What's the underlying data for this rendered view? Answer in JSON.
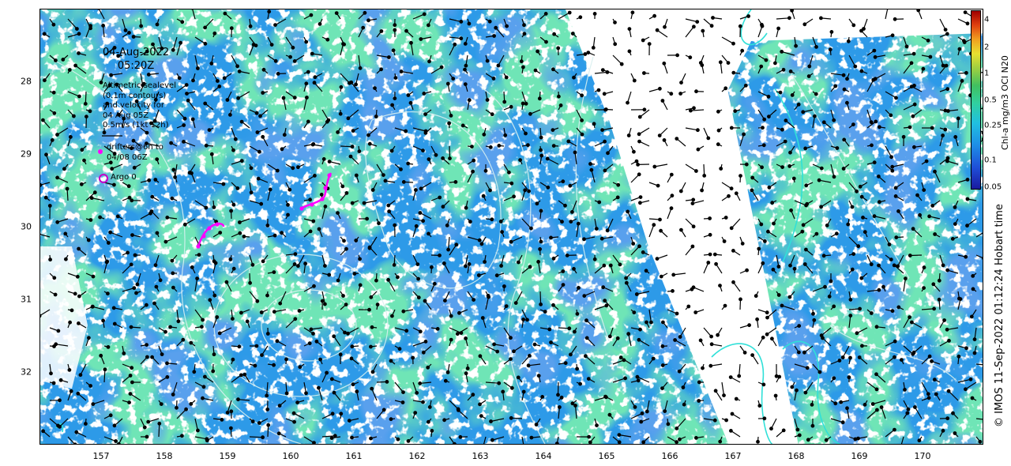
{
  "map": {
    "date_line1": "04-Aug-2022",
    "date_line2": "05:20Z",
    "x_ticks": [
      "157",
      "158",
      "159",
      "160",
      "161",
      "162",
      "163",
      "164",
      "165",
      "166",
      "167",
      "168",
      "169",
      "170"
    ],
    "y_ticks": [
      "28",
      "29",
      "30",
      "31",
      "32"
    ],
    "legend": {
      "altimetry": "Altimetric sealevel\n(0.1m contours)\nand velocity for\n04 Aug 05Z\n0.5m/s (1kt 12h)",
      "drifters": "drifters@6h to\n04/08 06Z",
      "argo": "Argo 0"
    },
    "colorbar": {
      "label": "Chl-a mg/m3 OCI N20",
      "ticks": [
        "4",
        "2",
        "1",
        "0.5",
        "0.25",
        "0.1",
        "0.05"
      ]
    },
    "credit": "© IMOS 11-Sep-2022 01:12:24 Hobart time",
    "colors": {
      "ocean_blue": "#2a8ef0",
      "ocean_green": "#2ec878",
      "contour": "#d8f0f0",
      "contour_cyan": "#30e0d8",
      "drifter": "#ff00ff",
      "argo": "#c800c8"
    }
  }
}
